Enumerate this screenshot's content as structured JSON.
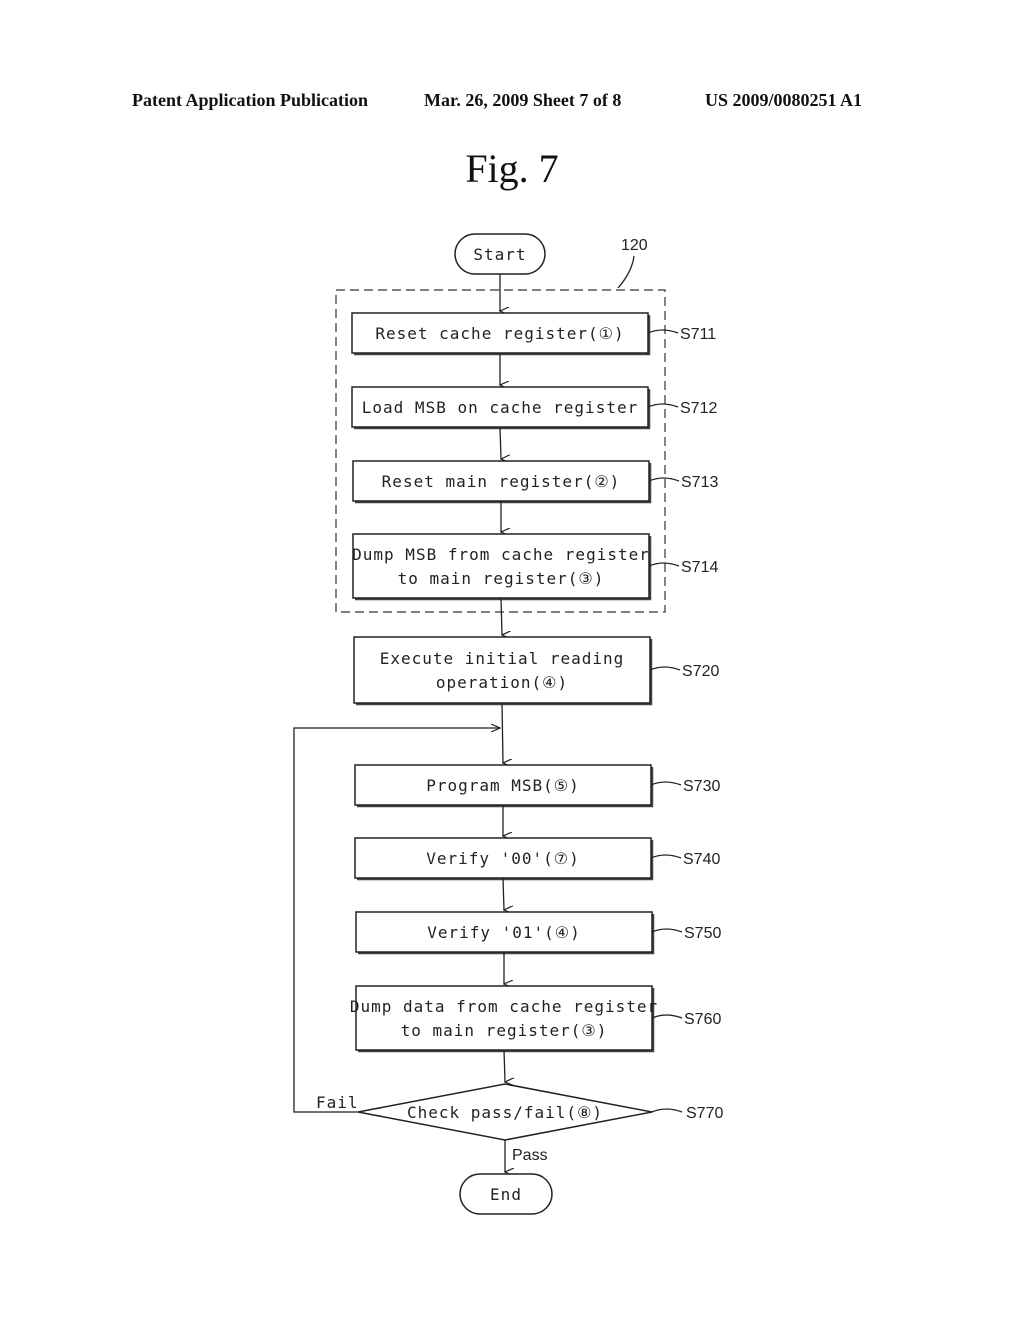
{
  "header": {
    "left": "Patent Application Publication",
    "center": "Mar. 26, 2009  Sheet 7 of 8",
    "right": "US 2009/0080251 A1"
  },
  "figure_title": "Fig.  7",
  "diagram": {
    "group_ref": "120",
    "start": "Start",
    "end": "End",
    "steps": [
      {
        "id": "S711",
        "lines": [
          "Reset cache register(①)"
        ]
      },
      {
        "id": "S712",
        "lines": [
          "Load MSB on cache register"
        ]
      },
      {
        "id": "S713",
        "lines": [
          "Reset main register(②)"
        ]
      },
      {
        "id": "S714",
        "lines": [
          "Dump MSB from cache register",
          "to main register(③)"
        ]
      },
      {
        "id": "S720",
        "lines": [
          "Execute initial reading",
          "operation(④)"
        ]
      },
      {
        "id": "S730",
        "lines": [
          "Program MSB(⑤)"
        ]
      },
      {
        "id": "S740",
        "lines": [
          "Verify '00'(⑦)"
        ]
      },
      {
        "id": "S750",
        "lines": [
          "Verify '01'(④)"
        ]
      },
      {
        "id": "S760",
        "lines": [
          "Dump data from cache register",
          "to main register(③)"
        ]
      }
    ],
    "decision": {
      "id": "S770",
      "text": "Check pass/fail(⑧)",
      "fail_label": "Fail",
      "pass_label": "Pass"
    }
  }
}
